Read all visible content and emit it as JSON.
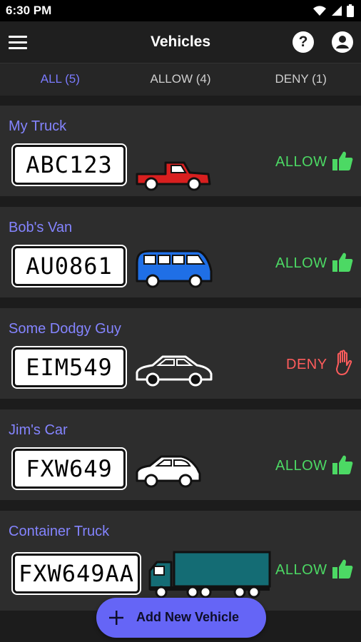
{
  "status_bar": {
    "time": "6:30 PM",
    "icons": [
      "wifi-icon",
      "signal-icon",
      "battery-icon"
    ]
  },
  "app_bar": {
    "title": "Vehicles",
    "menu_icon": "hamburger-menu-icon",
    "help_icon": "help-icon",
    "help_glyph": "?",
    "account_icon": "account-icon"
  },
  "tabs": [
    {
      "label": "ALL (5)",
      "active": true
    },
    {
      "label": "ALLOW (4)",
      "active": false
    },
    {
      "label": "DENY (1)",
      "active": false
    }
  ],
  "vehicles": [
    {
      "name": "My Truck",
      "plate": "ABC123",
      "type": "pickup-truck",
      "color": "#d81f1f",
      "status": "ALLOW"
    },
    {
      "name": "Bob's Van",
      "plate": "AU0861",
      "type": "van",
      "color": "#1f6fe6",
      "status": "ALLOW"
    },
    {
      "name": "Some Dodgy Guy",
      "plate": "EIM549",
      "type": "sedan",
      "color": "#111111",
      "status": "DENY"
    },
    {
      "name": "Jim's Car",
      "plate": "FXW649",
      "type": "hatchback",
      "color": "#ffffff",
      "status": "ALLOW"
    },
    {
      "name": "Container Truck",
      "plate": "FXW649AA",
      "type": "container-truck",
      "color": "#146c74",
      "status": "ALLOW"
    }
  ],
  "fab": {
    "label": "Add New Vehicle",
    "icon": "plus-icon"
  },
  "colors": {
    "accent": "#7b7bff",
    "allow": "#4cd964",
    "deny": "#ff5c5c",
    "fab": "#6565f6"
  }
}
